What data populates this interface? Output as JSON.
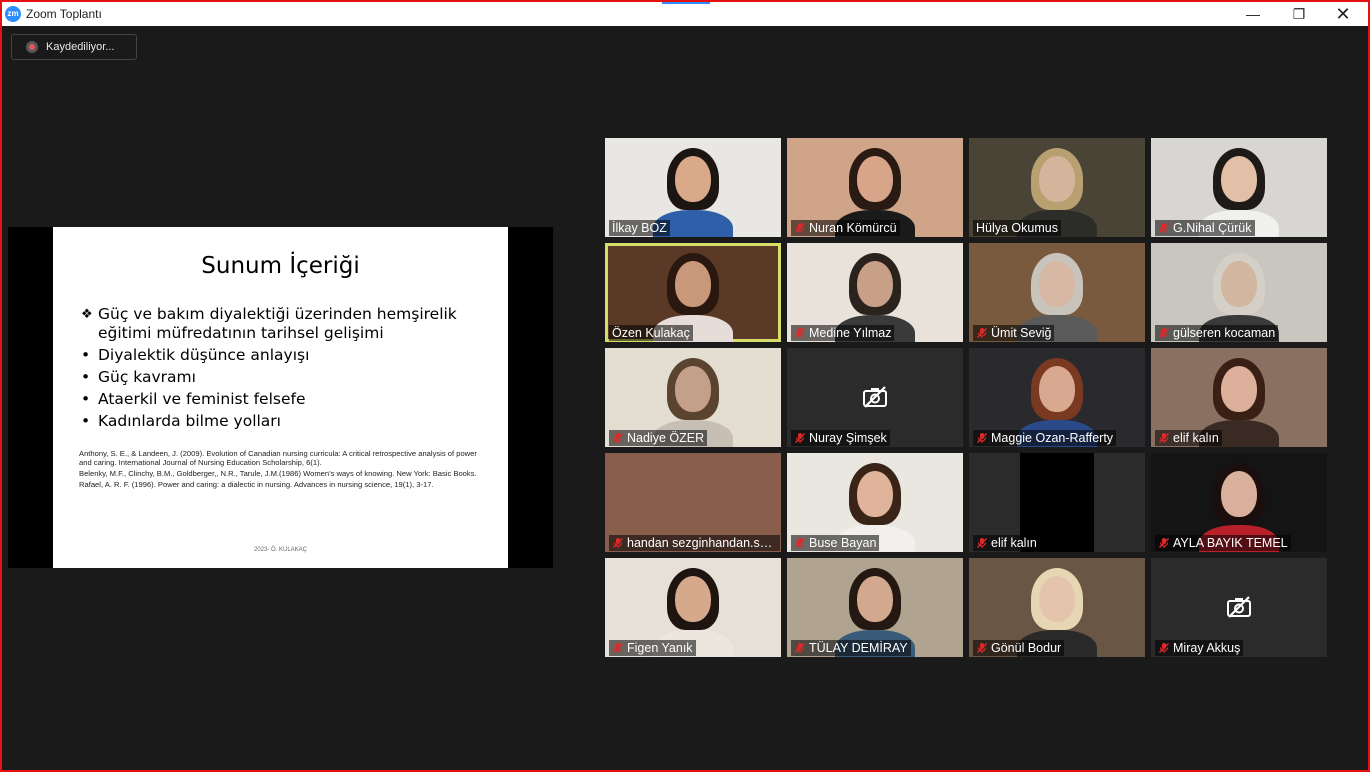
{
  "window": {
    "logo_text": "zm",
    "title": "Zoom Toplantı",
    "minimize": "—",
    "restore": "❐",
    "close": "✕"
  },
  "recording": {
    "label": "Kaydediliyor..."
  },
  "slide": {
    "title": "Sunum İçeriği",
    "bullets": [
      "Güç ve bakım diyalektiği üzerinden hemşirelik eğitimi müfredatının tarihsel gelişimi",
      "Diyalektik düşünce anlayışı",
      "Güç kavramı",
      "Ataerkil ve feminist felsefe",
      "Kadınlarda bilme yolları"
    ],
    "references": [
      "Anthony, S. E., & Landeen, J. (2009). Evolution of Canadian nursing curricula: A critical retrospective analysis of power and caring. International Journal of Nursing Education Scholarship, 6(1).",
      "Belenky, M.F., Clinchy, B.M., Goldberger,, N.R., Tarule, J.M.(1986) Women's ways of knowing. New York: Basic Books.",
      "Rafael, A. R. F. (1996). Power and caring: a dialectic in nursing. Advances in nursing science, 19(1), 3-17."
    ],
    "footer": "2023- Ö. KULAKAÇ"
  },
  "participants": [
    {
      "name": "İlkay BOZ",
      "muted": false,
      "video": true,
      "active": false,
      "bg": "#e9e7e3",
      "skin": "#d9a98a",
      "hair": "#1c1613",
      "shirt": "#2f5fa8"
    },
    {
      "name": "Nuran Kömürcü",
      "muted": true,
      "video": true,
      "active": false,
      "bg": "#cfa488",
      "skin": "#d8a58a",
      "hair": "#2a1a14",
      "shirt": "#1a1a1a"
    },
    {
      "name": "Hülya Okumus",
      "muted": false,
      "video": true,
      "active": false,
      "bg": "#4a4436",
      "skin": "#d4b49a",
      "hair": "#b8a070",
      "shirt": "#2c2c28"
    },
    {
      "name": "G.Nihal Çürük",
      "muted": true,
      "video": true,
      "active": false,
      "bg": "#d8d6d2",
      "skin": "#e2bfa6",
      "hair": "#1e1a18",
      "shirt": "#f0f0ee"
    },
    {
      "name": "Özen Kulakaç",
      "muted": false,
      "video": true,
      "active": true,
      "bg": "#5a3a26",
      "skin": "#c9987a",
      "hair": "#2a1810",
      "shirt": "#e6dcd8"
    },
    {
      "name": "Medine Yılmaz",
      "muted": true,
      "video": true,
      "active": false,
      "bg": "#e8e2da",
      "skin": "#c8a088",
      "hair": "#2a221c",
      "shirt": "#3a3a3a"
    },
    {
      "name": "Ümit Seviğ",
      "muted": true,
      "video": true,
      "active": false,
      "bg": "#7a5a3e",
      "skin": "#d6b8a4",
      "hair": "#c8c4bc",
      "shirt": "#5a5a5a"
    },
    {
      "name": "gülseren kocaman",
      "muted": true,
      "video": true,
      "active": false,
      "bg": "#c8c6be",
      "skin": "#d2b6a0",
      "hair": "#d4d0c8",
      "shirt": "#3a3a3a"
    },
    {
      "name": "Nadiye ÖZER",
      "muted": true,
      "video": true,
      "active": false,
      "bg": "#e4ddd2",
      "skin": "#c4a08a",
      "hair": "#5a4430",
      "shirt": "#c8bfb4"
    },
    {
      "name": "Nuray Şimşek",
      "muted": true,
      "video": false,
      "active": false,
      "bg": "#2b2b2b"
    },
    {
      "name": "Maggie Ozan-Rafferty",
      "muted": true,
      "video": true,
      "active": false,
      "bg": "#2a2a2e",
      "skin": "#d8a890",
      "hair": "#7a3a22",
      "shirt": "#2a4a8a"
    },
    {
      "name": "elif kalın",
      "muted": true,
      "video": true,
      "active": false,
      "bg": "#8a7060",
      "skin": "#dcb09a",
      "hair": "#3a2014",
      "shirt": "#3a2a24"
    },
    {
      "name": "handan sezginhandan.sezgin",
      "muted": true,
      "video": true,
      "active": false,
      "bg": "#8a5e4c",
      "plain": true
    },
    {
      "name": "Buse Bayan",
      "muted": true,
      "video": true,
      "active": false,
      "bg": "#eae6e0",
      "skin": "#e0b49a",
      "hair": "#3a2418",
      "shirt": "#f2f0ec"
    },
    {
      "name": "elif kalın",
      "muted": true,
      "video": true,
      "active": false,
      "bg": "#2b2b2b",
      "black_box": true
    },
    {
      "name": "AYLA BAYIK TEMEL",
      "muted": true,
      "video": true,
      "active": false,
      "bg": "#141414",
      "skin": "#d8b09c",
      "hair": "#1a0e0e",
      "shirt": "#b8202a"
    },
    {
      "name": "Figen Yanık",
      "muted": true,
      "video": true,
      "active": false,
      "bg": "#e6e0d8",
      "skin": "#d6a88c",
      "hair": "#1e1410",
      "shirt": "#ece6de"
    },
    {
      "name": "TÜLAY DEMİRAY",
      "muted": true,
      "video": true,
      "active": false,
      "bg": "#b0a490",
      "skin": "#d2a88e",
      "hair": "#241812",
      "shirt": "#3a5a7a"
    },
    {
      "name": "Gönül Bodur",
      "muted": true,
      "video": true,
      "active": false,
      "bg": "#6a5644",
      "skin": "#e4c4ac",
      "hair": "#e6d6b4",
      "shirt": "#2a2a2a"
    },
    {
      "name": "Miray Akkuş",
      "muted": true,
      "video": false,
      "active": false,
      "bg": "#2b2b2b"
    }
  ]
}
